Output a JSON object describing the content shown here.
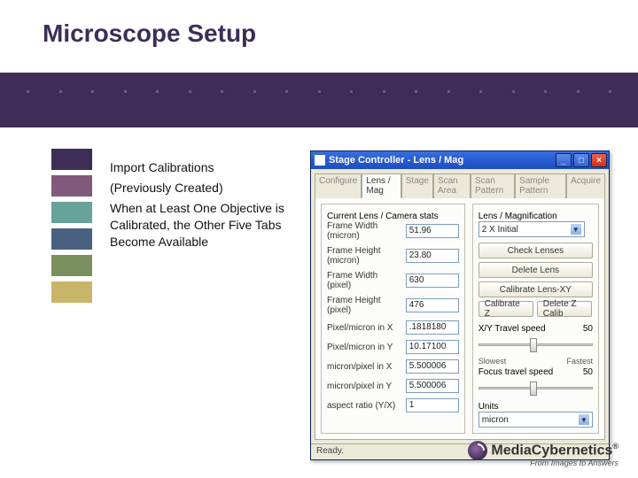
{
  "slide": {
    "title": "Microscope Setup",
    "bullets": [
      "Import Calibrations",
      "(Previously Created)",
      "When at Least One Objective is Calibrated, the Other Five Tabs Become Available"
    ]
  },
  "logo": {
    "name": "MediaCybernetics",
    "tagline": "From Images to Answers",
    "reg": "®"
  },
  "window": {
    "title": "Stage Controller - Lens / Mag",
    "tabs": [
      "Configure",
      "Lens / Mag",
      "Stage",
      "Scan Area",
      "Scan Pattern",
      "Sample Pattern",
      "Acquire"
    ],
    "active_tab": 1,
    "group_left_title": "Current Lens / Camera stats",
    "fields_left": {
      "frame_width_micron": {
        "label": "Frame Width (micron)",
        "value": "51.96"
      },
      "frame_height_micron": {
        "label": "Frame Height (micron)",
        "value": "23.80"
      },
      "frame_width_pixel": {
        "label": "Frame Width (pixel)",
        "value": "630"
      },
      "frame_height_pixel": {
        "label": "Frame Height (pixel)",
        "value": "476"
      },
      "pixel_micron_x": {
        "label": "Pixel/micron in X",
        "value": ".1818180"
      },
      "pixel_micron_y": {
        "label": "Pixel/micron in Y",
        "value": "10.17100"
      },
      "micron_pixel_x": {
        "label": "micron/pixel in X",
        "value": "5.500006"
      },
      "micron_pixel_y": {
        "label": "micron/pixel in Y",
        "value": "5.500006"
      },
      "aspect_ratio": {
        "label": "aspect ratio (Y/X)",
        "value": "1"
      }
    },
    "group_right_title": "Lens / Magnification",
    "lens_select": "2 X Initial",
    "buttons": {
      "check_lenses": "Check Lenses",
      "delete_lens": "Delete Lens",
      "calibrate_xy": "Calibrate Lens-XY",
      "calibrate_z": "Calibrate Z",
      "delete_z": "Delete Z Calib"
    },
    "sliders": {
      "xy_travel": {
        "label": "X/Y Travel speed",
        "value": "50",
        "thumb": 0.45
      },
      "focus": {
        "label": "Focus travel speed",
        "value": "50",
        "thumb": 0.45,
        "lo": "Slowest",
        "hi": "Fastest"
      }
    },
    "units": {
      "label": "Units",
      "value": "micron"
    },
    "status": "Ready."
  }
}
